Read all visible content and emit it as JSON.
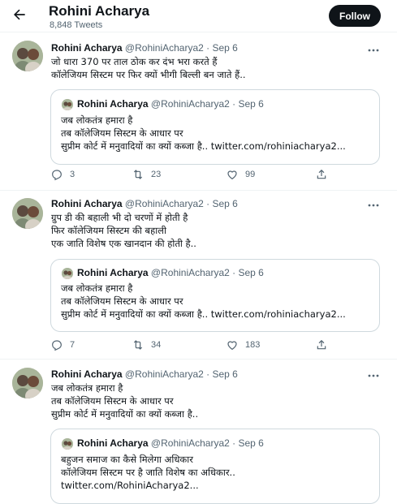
{
  "header": {
    "name": "Rohini Acharya",
    "tweet_count": "8,848 Tweets",
    "follow_label": "Follow"
  },
  "tweets": [
    {
      "author": "Rohini Acharya",
      "handle_date": "@RohiniAcharya2 · Sep 6",
      "lines": [
        "जो धारा 370 पर ताल ठोक कर दंभ भरा करते हैं",
        "कॉलेजियम सिस्टम पर फिर क्यों भीगी बिल्ली बन जाते हैं.."
      ],
      "quote": {
        "author": "Rohini Acharya",
        "handle_date": "@RohiniAcharya2 · Sep 6",
        "lines": [
          "जब लोकतंत्र हमारा है",
          "तब कॉलेजियम सिस्टम के आधार पर",
          "सुप्रीम कोर्ट में मनुवादियों का क्यों कब्जा है.. twitter.com/rohiniacharya2..."
        ]
      },
      "replies": "3",
      "retweets": "23",
      "likes": "99"
    },
    {
      "author": "Rohini Acharya",
      "handle_date": "@RohiniAcharya2 · Sep 6",
      "lines": [
        "ग्रुप डी की बहाली भी दो चरणों में होती है",
        "फिर कॉलेजियम सिस्टम की बहाली",
        "एक जाति विशेष एक खानदान की होती है.."
      ],
      "quote": {
        "author": "Rohini Acharya",
        "handle_date": "@RohiniAcharya2 · Sep 6",
        "lines": [
          "जब लोकतंत्र हमारा है",
          "तब कॉलेजियम सिस्टम के आधार पर",
          "सुप्रीम कोर्ट में मनुवादियों का क्यों कब्जा है.. twitter.com/rohiniacharya2..."
        ]
      },
      "replies": "7",
      "retweets": "34",
      "likes": "183"
    },
    {
      "author": "Rohini Acharya",
      "handle_date": "@RohiniAcharya2 · Sep 6",
      "lines": [
        "जब लोकतंत्र हमारा है",
        "तब कॉलेजियम सिस्टम के आधार पर",
        "सुप्रीम कोर्ट में मनुवादियों का क्यों कब्जा है.."
      ],
      "quote": {
        "author": "Rohini Acharya",
        "handle_date": "@RohiniAcharya2 · Sep 6",
        "lines": [
          "बहुजन समाज का कैसे मिलेगा अधिकार",
          "कॉलेजियम सिस्टम पर है जाति विशेष का अधिकार..",
          "twitter.com/RohiniAcharya2..."
        ]
      }
    }
  ],
  "icons": {
    "back": "arrow-left-icon",
    "more": "more-horizontal-icon",
    "reply": "reply-icon",
    "retweet": "retweet-icon",
    "like": "heart-icon",
    "share": "share-icon"
  },
  "colors": {
    "text": "#0f1419",
    "secondary": "#536471",
    "border": "#cfd9de",
    "follow_bg": "#0f1419"
  }
}
